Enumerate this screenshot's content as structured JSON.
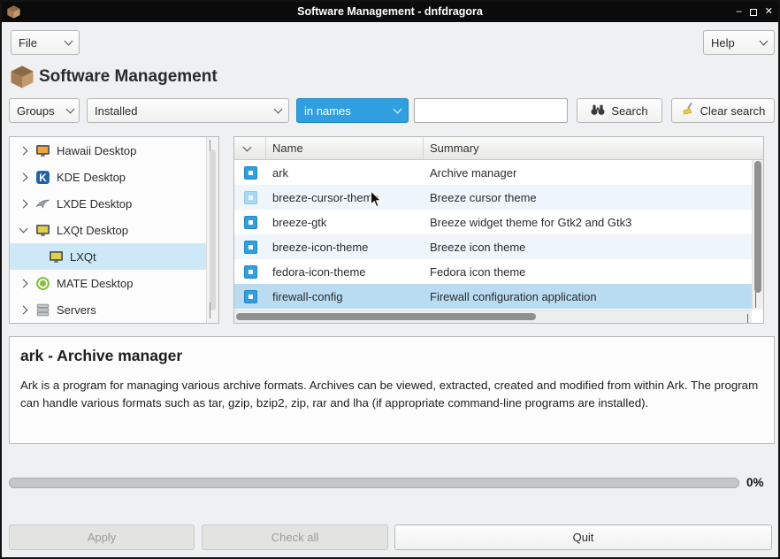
{
  "window": {
    "title": "Software Management - dnfdragora",
    "controls": {
      "minimize": "–",
      "close": "✕"
    }
  },
  "menubar": {
    "file_label": "File",
    "help_label": "Help"
  },
  "header": {
    "title": "Software Management"
  },
  "filters": {
    "groups_label": "Groups",
    "view_filter": "Installed",
    "search_scope": "in names",
    "search_value": "",
    "search_button_label": "Search",
    "clear_button_label": "Clear search"
  },
  "tree": {
    "items": [
      {
        "label": "Hawaii Desktop",
        "expanded": false
      },
      {
        "label": "KDE Desktop",
        "expanded": false
      },
      {
        "label": "LXDE Desktop",
        "expanded": false
      },
      {
        "label": "LXQt Desktop",
        "expanded": true
      },
      {
        "label": "LXQt",
        "child": true,
        "selected": true
      },
      {
        "label": "MATE Desktop",
        "expanded": false
      },
      {
        "label": "Servers",
        "expanded": false
      }
    ]
  },
  "table": {
    "columns": {
      "name": "Name",
      "summary": "Summary"
    },
    "rows": [
      {
        "name": "ark",
        "summary": "Archive manager",
        "checked": true
      },
      {
        "name": "breeze-cursor-theme",
        "summary": "Breeze cursor theme",
        "checked": true
      },
      {
        "name": "breeze-gtk",
        "summary": "Breeze widget theme for Gtk2 and Gtk3",
        "checked": true
      },
      {
        "name": "breeze-icon-theme",
        "summary": "Breeze icon theme",
        "checked": true
      },
      {
        "name": "fedora-icon-theme",
        "summary": "Fedora icon theme",
        "checked": true
      },
      {
        "name": "firewall-config",
        "summary": "Firewall configuration application",
        "checked": true,
        "selected": true
      }
    ]
  },
  "details": {
    "title": "ark - Archive manager",
    "description": "Ark is a program for managing various archive formats. Archives can be viewed, extracted, created and modified from within Ark. The program can handle various formats such as tar, gzip, bzip2, zip, rar and lha (if appropriate command-line programs are installed)."
  },
  "progress": {
    "percent_label": "0%",
    "value": 0
  },
  "actions": {
    "apply_label": "Apply",
    "check_all_label": "Check all",
    "quit_label": "Quit"
  },
  "colors": {
    "accent": "#3daee9",
    "selection": "#b9dcf2",
    "titlebar": "#0b0b0b"
  }
}
